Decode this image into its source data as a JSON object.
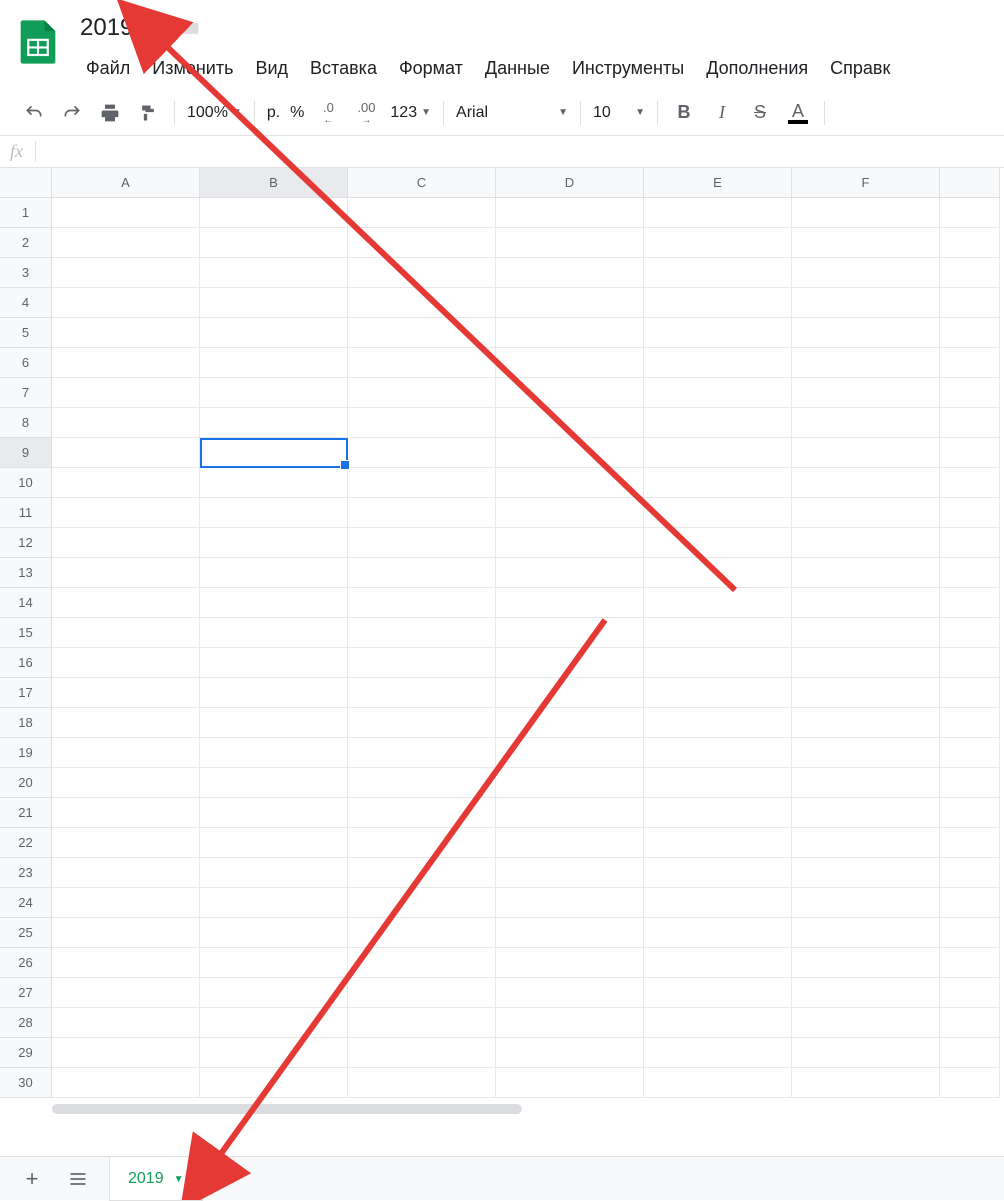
{
  "header": {
    "title": "2019"
  },
  "menu": {
    "items": [
      "Файл",
      "Изменить",
      "Вид",
      "Вставка",
      "Формат",
      "Данные",
      "Инструменты",
      "Дополнения",
      "Справк"
    ]
  },
  "toolbar": {
    "zoom": "100%",
    "currency": "р.",
    "percent": "%",
    "dec_less": ".0",
    "dec_more": ".00",
    "more_formats": "123",
    "font": "Arial",
    "font_size": "10",
    "bold": "B",
    "italic": "I",
    "strike": "S",
    "text_color": "A"
  },
  "formula_bar": {
    "fx": "fx",
    "value": ""
  },
  "grid": {
    "columns": [
      "A",
      "B",
      "C",
      "D",
      "E",
      "F"
    ],
    "rows": [
      "1",
      "2",
      "3",
      "4",
      "5",
      "6",
      "7",
      "8",
      "9",
      "10",
      "11",
      "12",
      "13",
      "14",
      "15",
      "16",
      "17",
      "18",
      "19",
      "20",
      "21",
      "22",
      "23",
      "24",
      "25",
      "26",
      "27",
      "28",
      "29",
      "30"
    ],
    "selected_cell": "B9"
  },
  "sheet_bar": {
    "active_tab": "2019"
  }
}
